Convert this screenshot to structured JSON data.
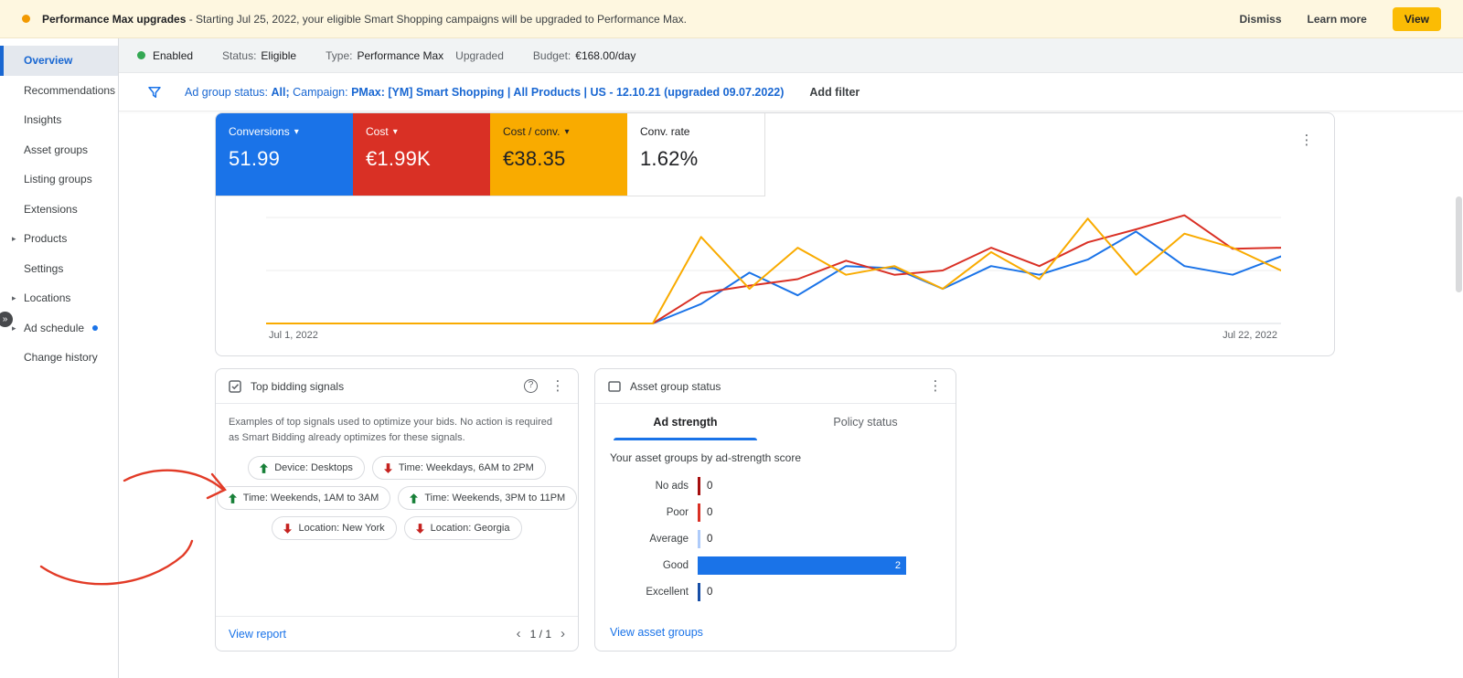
{
  "banner": {
    "title": "Performance Max upgrades",
    "message": " - Starting Jul 25, 2022, your eligible Smart Shopping campaigns will be upgraded to Performance Max.",
    "dismiss_label": "Dismiss",
    "learn_more_label": "Learn more",
    "view_label": "View",
    "view_button_color": "#fbbc04"
  },
  "icons": {
    "kebab": "⋮",
    "caret": "▾",
    "expand": "▸",
    "collapse": "»",
    "help": "?",
    "prev": "‹",
    "next": "›"
  },
  "sidebar": {
    "items": [
      {
        "label": "Overview",
        "selected": true,
        "expandable": false,
        "dot": false
      },
      {
        "label": "Recommendations",
        "selected": false,
        "expandable": false,
        "dot": false
      },
      {
        "label": "Insights",
        "selected": false,
        "expandable": false,
        "dot": false
      },
      {
        "label": "Asset groups",
        "selected": false,
        "expandable": false,
        "dot": false
      },
      {
        "label": "Listing groups",
        "selected": false,
        "expandable": false,
        "dot": false
      },
      {
        "label": "Extensions",
        "selected": false,
        "expandable": false,
        "dot": false
      },
      {
        "label": "Products",
        "selected": false,
        "expandable": true,
        "dot": false
      },
      {
        "label": "Settings",
        "selected": false,
        "expandable": false,
        "dot": false
      },
      {
        "label": "Locations",
        "selected": false,
        "expandable": true,
        "dot": false
      },
      {
        "label": "Ad schedule",
        "selected": false,
        "expandable": true,
        "dot": true
      },
      {
        "label": "Change history",
        "selected": false,
        "expandable": false,
        "dot": false
      }
    ]
  },
  "status_bar": {
    "enabled_label": "Enabled",
    "enabled_color": "#34a853",
    "status_label": "Status:",
    "status_value": "Eligible",
    "type_label": "Type:",
    "type_value": "Performance Max",
    "type_suffix": "Upgraded",
    "budget_label": "Budget:",
    "budget_value": "€168.00/day"
  },
  "filter_bar": {
    "group_label": "Ad group status:",
    "group_value": "All;",
    "campaign_label": "Campaign:",
    "campaign_value": "PMax: [YM] Smart Shopping | All Products | US - 12.10.21 (upgraded 09.07.2022)",
    "add_filter_label": "Add filter"
  },
  "metrics": [
    {
      "label": "Conversions",
      "value": "51.99",
      "bg": "#1a73e8",
      "text": "#ffffff",
      "dropdown": true
    },
    {
      "label": "Cost",
      "value": "€1.99K",
      "bg": "#d93025",
      "text": "#ffffff",
      "dropdown": true
    },
    {
      "label": "Cost / conv.",
      "value": "€38.35",
      "bg": "#f9ab00",
      "text": "#202124",
      "dropdown": true
    },
    {
      "label": "Conv. rate",
      "value": "1.62%",
      "bg": "#ffffff",
      "text": "#202124",
      "dropdown": false
    }
  ],
  "chart_data": [
    {
      "type": "line",
      "x_start_label": "Jul 1, 2022",
      "x_end_label": "Jul 22, 2022",
      "x_unit": "daily, Jul 1 - Jul 22, 2022",
      "y_axis": "unlabeled; values are normalized 0-100 estimates read from the plot",
      "grid": true,
      "legend_position": "none",
      "series": [
        {
          "name": "Conversions",
          "color": "#1a73e8",
          "values": [
            0,
            0,
            0,
            0,
            0,
            0,
            0,
            0,
            0,
            18,
            47,
            26,
            53,
            51,
            32,
            53,
            45,
            59,
            85,
            53,
            45,
            62
          ]
        },
        {
          "name": "Cost",
          "color": "#d93025",
          "values": [
            0,
            0,
            0,
            0,
            0,
            0,
            0,
            0,
            0,
            28,
            35,
            41,
            58,
            45,
            49,
            70,
            53,
            75,
            87,
            100,
            69,
            70
          ]
        },
        {
          "name": "Cost / conv.",
          "color": "#f9ab00",
          "values": [
            0,
            0,
            0,
            0,
            0,
            0,
            0,
            0,
            0,
            80,
            32,
            70,
            45,
            53,
            32,
            66,
            41,
            97,
            45,
            83,
            70,
            49
          ]
        }
      ]
    },
    {
      "type": "bar",
      "orientation": "horizontal",
      "title": "Your asset groups by ad-strength score",
      "categories": [
        "No ads",
        "Poor",
        "Average",
        "Good",
        "Excellent"
      ],
      "values": [
        0,
        0,
        0,
        2,
        0
      ],
      "colors": [
        "#a50e0e",
        "#d93025",
        "#aecbfa",
        "#1a73e8",
        "#174ea6"
      ],
      "xlim": [
        0,
        2
      ],
      "grid": false
    }
  ],
  "signals_card": {
    "title": "Top bidding signals",
    "description": "Examples of top signals used to optimize your bids. No action is required as Smart Bidding already optimizes for these signals.",
    "up_color": "#188038",
    "down_color": "#c5221f",
    "chips": [
      {
        "direction": "up",
        "label": "Device: Desktops"
      },
      {
        "direction": "down",
        "label": "Time: Weekdays, 6AM to 2PM"
      },
      {
        "direction": "up",
        "label": "Time: Weekends, 1AM to 3AM"
      },
      {
        "direction": "up",
        "label": "Time: Weekends, 3PM to 11PM"
      },
      {
        "direction": "down",
        "label": "Location: New York"
      },
      {
        "direction": "down",
        "label": "Location: Georgia"
      }
    ],
    "view_report_label": "View report",
    "pagination": "1 / 1"
  },
  "strength_card": {
    "title": "Asset group status",
    "tabs": [
      "Ad strength",
      "Policy status"
    ],
    "active_tab": 0,
    "subtitle": "Your asset groups by ad-strength score",
    "view_link_label": "View asset groups"
  }
}
